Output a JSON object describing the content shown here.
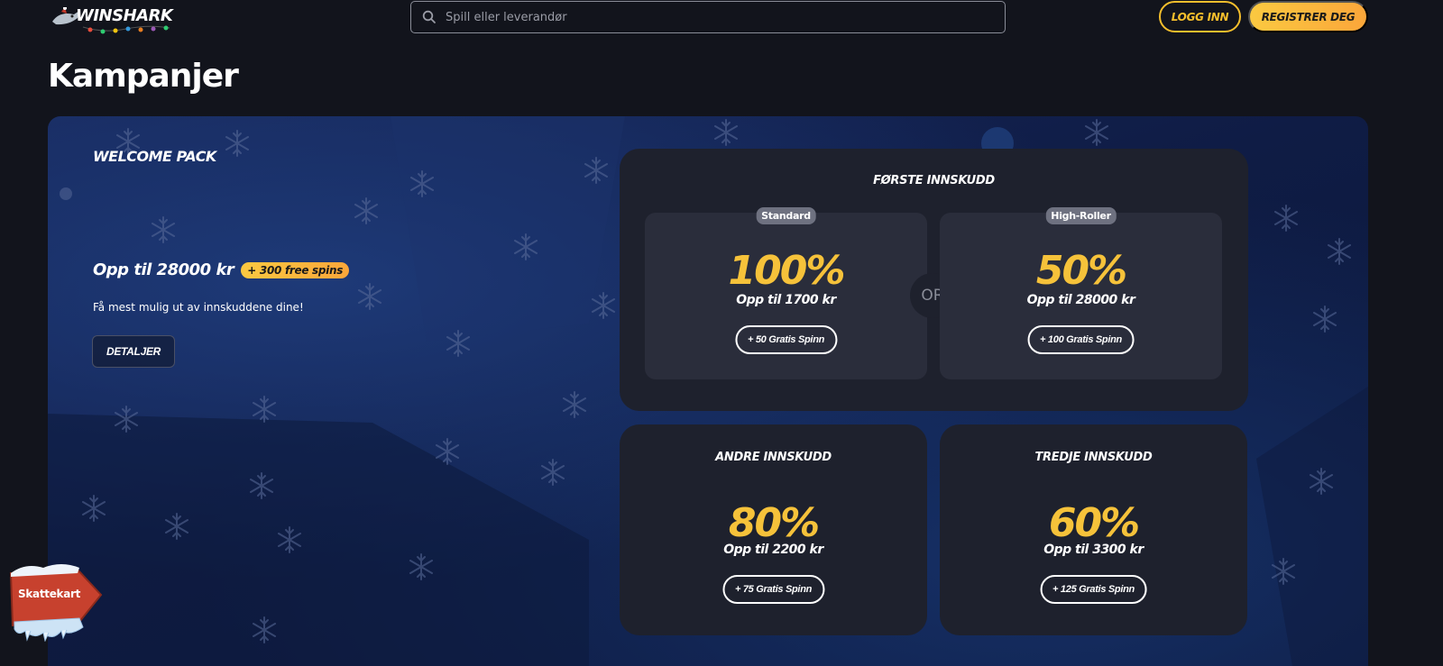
{
  "header": {
    "logo_text": "WINSHARK",
    "search_placeholder": "Spill eller leverandør",
    "login_label": "LOGG INN",
    "register_label": "REGISTRER DEG"
  },
  "page_title": "Kampanjer",
  "welcome": {
    "title": "WELCOME PACK",
    "offer": "Opp til 28000 kr",
    "badge": "+ 300 free spins",
    "subtitle": "Få mest mulig ut av innskuddene dine!",
    "details_label": "DETALJER"
  },
  "first_deposit": {
    "title": "FØRSTE INNSKUDD",
    "or_label": "OR",
    "standard": {
      "tag": "Standard",
      "percent": "100%",
      "upto": "Opp til 1700 kr",
      "spins": "+ 50 Gratis Spinn"
    },
    "high_roller": {
      "tag": "High-Roller",
      "percent": "50%",
      "upto": "Opp til 28000 kr",
      "spins": "+ 100 Gratis Spinn"
    }
  },
  "second_deposit": {
    "title": "ANDRE INNSKUDD",
    "percent": "80%",
    "upto": "Opp til 2200 kr",
    "spins": "+ 75 Gratis Spinn"
  },
  "third_deposit": {
    "title": "TREDJE INNSKUDD",
    "percent": "60%",
    "upto": "Opp til 3300 kr",
    "spins": "+ 125 Gratis Spinn"
  },
  "treasure_map": {
    "label": "Skattekart"
  },
  "colors": {
    "background": "#12141c",
    "accent_yellow": "#f6c23a",
    "card": "#1e212d",
    "sub_card": "#2a2d3b",
    "promo_blue": "#17285c"
  }
}
